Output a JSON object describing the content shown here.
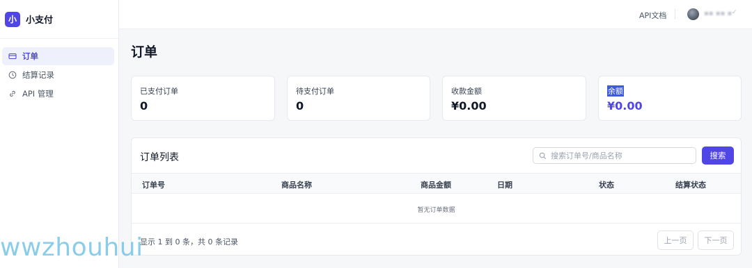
{
  "brand": {
    "logo_char": "小",
    "name": "小支付"
  },
  "sidebar": {
    "items": [
      {
        "label": "订单",
        "icon": "card-icon"
      },
      {
        "label": "结算记录",
        "icon": "clock-icon"
      },
      {
        "label": "API 管理",
        "icon": "link-icon"
      }
    ]
  },
  "topbar": {
    "doc_link": "API文档",
    "user_name": "▪▪ ▪▪ ▪"
  },
  "page": {
    "title": "订单"
  },
  "stats": [
    {
      "label": "已支付订单",
      "value": "0"
    },
    {
      "label": "待支付订单",
      "value": "0"
    },
    {
      "label": "收款金额",
      "value": "¥0.00"
    },
    {
      "label": "余额",
      "value": "¥0.00"
    }
  ],
  "orders": {
    "title": "订单列表",
    "search_placeholder": "搜索订单号/商品名称",
    "search_button": "搜索",
    "columns": [
      "订单号",
      "商品名称",
      "商品金额",
      "日期",
      "状态",
      "结算状态"
    ],
    "rows": [],
    "empty_text": "暂无订单数据",
    "record_count": "显示 1 到 0 条，共 0 条记录",
    "prev_button": "上一页",
    "next_button": "下一页"
  },
  "watermark": "wwzhouhui",
  "colors": {
    "accent": "#4f46e5",
    "selection": "#3b5bdb"
  }
}
